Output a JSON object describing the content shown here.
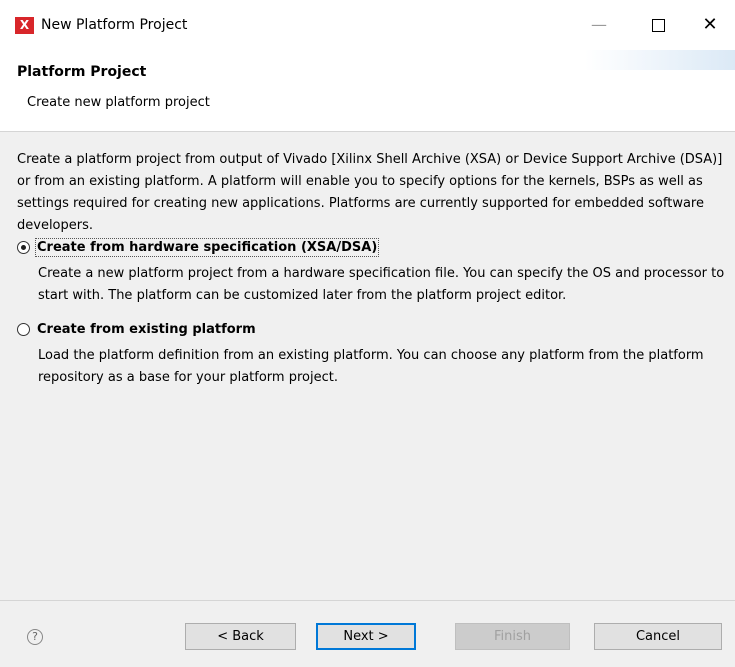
{
  "window": {
    "title": "New Platform Project",
    "app_icon_glyph": "X",
    "min_glyph": "—",
    "close_glyph": "✕"
  },
  "banner": {
    "title": "Platform Project",
    "description": "Create new platform project"
  },
  "intro": "Create a platform project from output of Vivado [Xilinx Shell Archive (XSA) or Device Support Archive (DSA)] or from an existing platform. A platform will enable you to specify options for the kernels, BSPs as well as settings required for creating new applications. Platforms are currently supported for embedded software developers.",
  "options": [
    {
      "label": "Create from hardware specification (XSA/DSA)",
      "description": "Create a new platform project from a hardware specification file. You can specify the OS and processor to start with. The platform can be customized later from the platform project editor.",
      "selected": true
    },
    {
      "label": "Create from existing platform",
      "description": "Load the platform definition from an existing platform. You can choose any platform from the platform repository as a base for your platform project.",
      "selected": false
    }
  ],
  "footer": {
    "help_glyph": "?",
    "back_label": "< Back",
    "next_label": "Next >",
    "finish_label": "Finish",
    "cancel_label": "Cancel"
  },
  "colors": {
    "app_icon": "#d8262a",
    "focus_border": "#0078d7"
  }
}
